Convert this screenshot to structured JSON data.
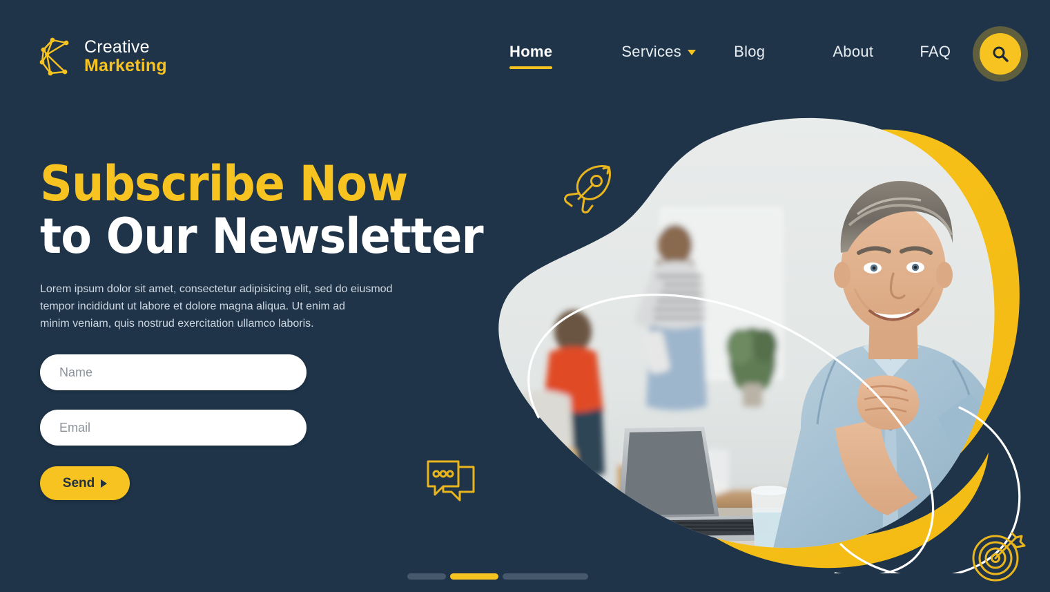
{
  "brand": {
    "logo_icon": "network-c-logo-icon",
    "line1": "Creative",
    "line2": "Marketing"
  },
  "nav": {
    "items": [
      {
        "label": "Home",
        "active": true,
        "has_dropdown": false
      },
      {
        "label": "Services",
        "active": false,
        "has_dropdown": true
      },
      {
        "label": "Blog",
        "active": false,
        "has_dropdown": false
      },
      {
        "label": "About",
        "active": false,
        "has_dropdown": false
      },
      {
        "label": "FAQ",
        "active": false,
        "has_dropdown": false
      }
    ],
    "search_icon": "search-icon"
  },
  "hero": {
    "headline_line1": "Subscribe Now",
    "headline_line2": "to Our Newsletter",
    "paragraph_line1": "Lorem ipsum dolor sit amet, consectetur adipisicing elit, sed do eiusmod",
    "paragraph_line2": "tempor incididunt ut labore et dolore magna aliqua. Ut enim ad",
    "paragraph_line3": "minim veniam, quis nostrud exercitation ullamco laboris."
  },
  "form": {
    "name_placeholder": "Name",
    "name_value": "",
    "email_placeholder": "Email",
    "email_value": "",
    "submit_label": "Send"
  },
  "decor_icons": [
    {
      "name": "rocket-icon"
    },
    {
      "name": "chat-bubbles-icon"
    },
    {
      "name": "target-dart-icon"
    }
  ],
  "hero_image": {
    "alt": "Smiling businessman at laptop in office with colleagues in background"
  },
  "slider": {
    "segments": [
      {
        "active": false
      },
      {
        "active": true
      },
      {
        "active": false
      }
    ]
  },
  "colors": {
    "background": "#1f3449",
    "accent_yellow": "#F7C320",
    "text_white": "#ffffff",
    "text_muted": "#cfd8e2",
    "slider_inactive": "#46586c",
    "field_background": "#ffffff",
    "placeholder": "#8b929a"
  }
}
